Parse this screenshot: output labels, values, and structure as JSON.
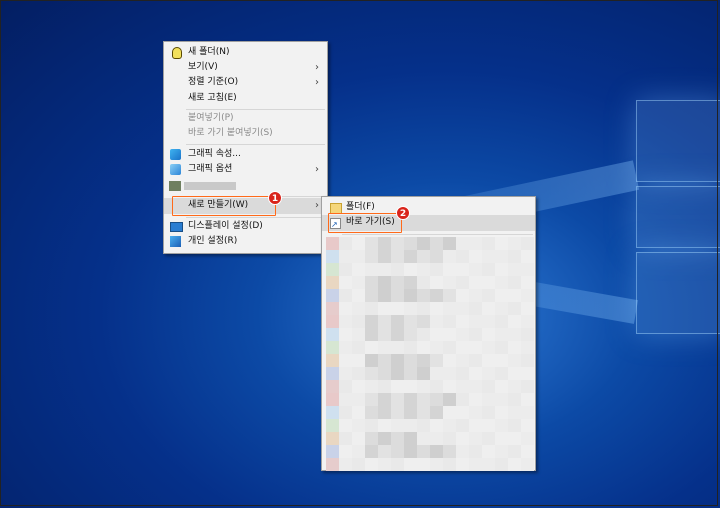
{
  "context_menu": {
    "items": [
      {
        "label": "새 폴더(N)"
      },
      {
        "label": "보기(V)"
      },
      {
        "label": "정렬 기준(O)"
      },
      {
        "label": "새로 고침(E)"
      },
      {
        "label": "붙여넣기(P)"
      },
      {
        "label": "바로 가기 붙여넣기(S)"
      },
      {
        "label": "그래픽 속성..."
      },
      {
        "label": "그래픽 옵션"
      },
      {
        "label": "새로 만들기(W)"
      },
      {
        "label": "디스플레이 설정(D)"
      },
      {
        "label": "개인 설정(R)"
      }
    ]
  },
  "submenu": {
    "items": [
      {
        "label": "폴더(F)"
      },
      {
        "label": "바로 가기(S)"
      }
    ]
  },
  "callouts": {
    "one": "1",
    "two": "2"
  },
  "colors": {
    "callout_border": "#ff6a1a",
    "badge": "#d9241b",
    "highlight": "#dadada"
  },
  "icons": [
    "bulb-icon",
    "graphics-icon",
    "display-icon",
    "personalize-icon",
    "folder-icon",
    "shortcut-icon"
  ]
}
